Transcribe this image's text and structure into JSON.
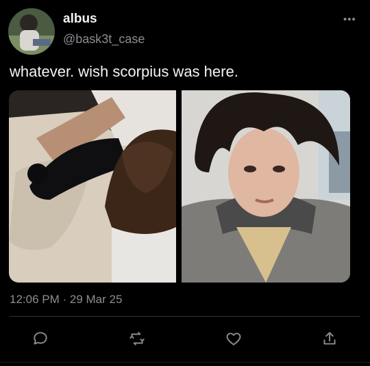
{
  "tweet": {
    "name": "albus",
    "handle": "@bask3t_case",
    "text": "whatever. wish scorpius was here.",
    "timestamp": "12:06 PM · 29 Mar 25",
    "more_icon": "more-horizontal-icon"
  },
  "actions": [
    {
      "name": "reply-icon"
    },
    {
      "name": "retweet-icon"
    },
    {
      "name": "like-icon"
    },
    {
      "name": "share-icon"
    }
  ],
  "colors": {
    "background": "#000000",
    "text_primary": "#e7e9ea",
    "text_secondary": "#8a8d91",
    "divider": "#2f3336"
  }
}
